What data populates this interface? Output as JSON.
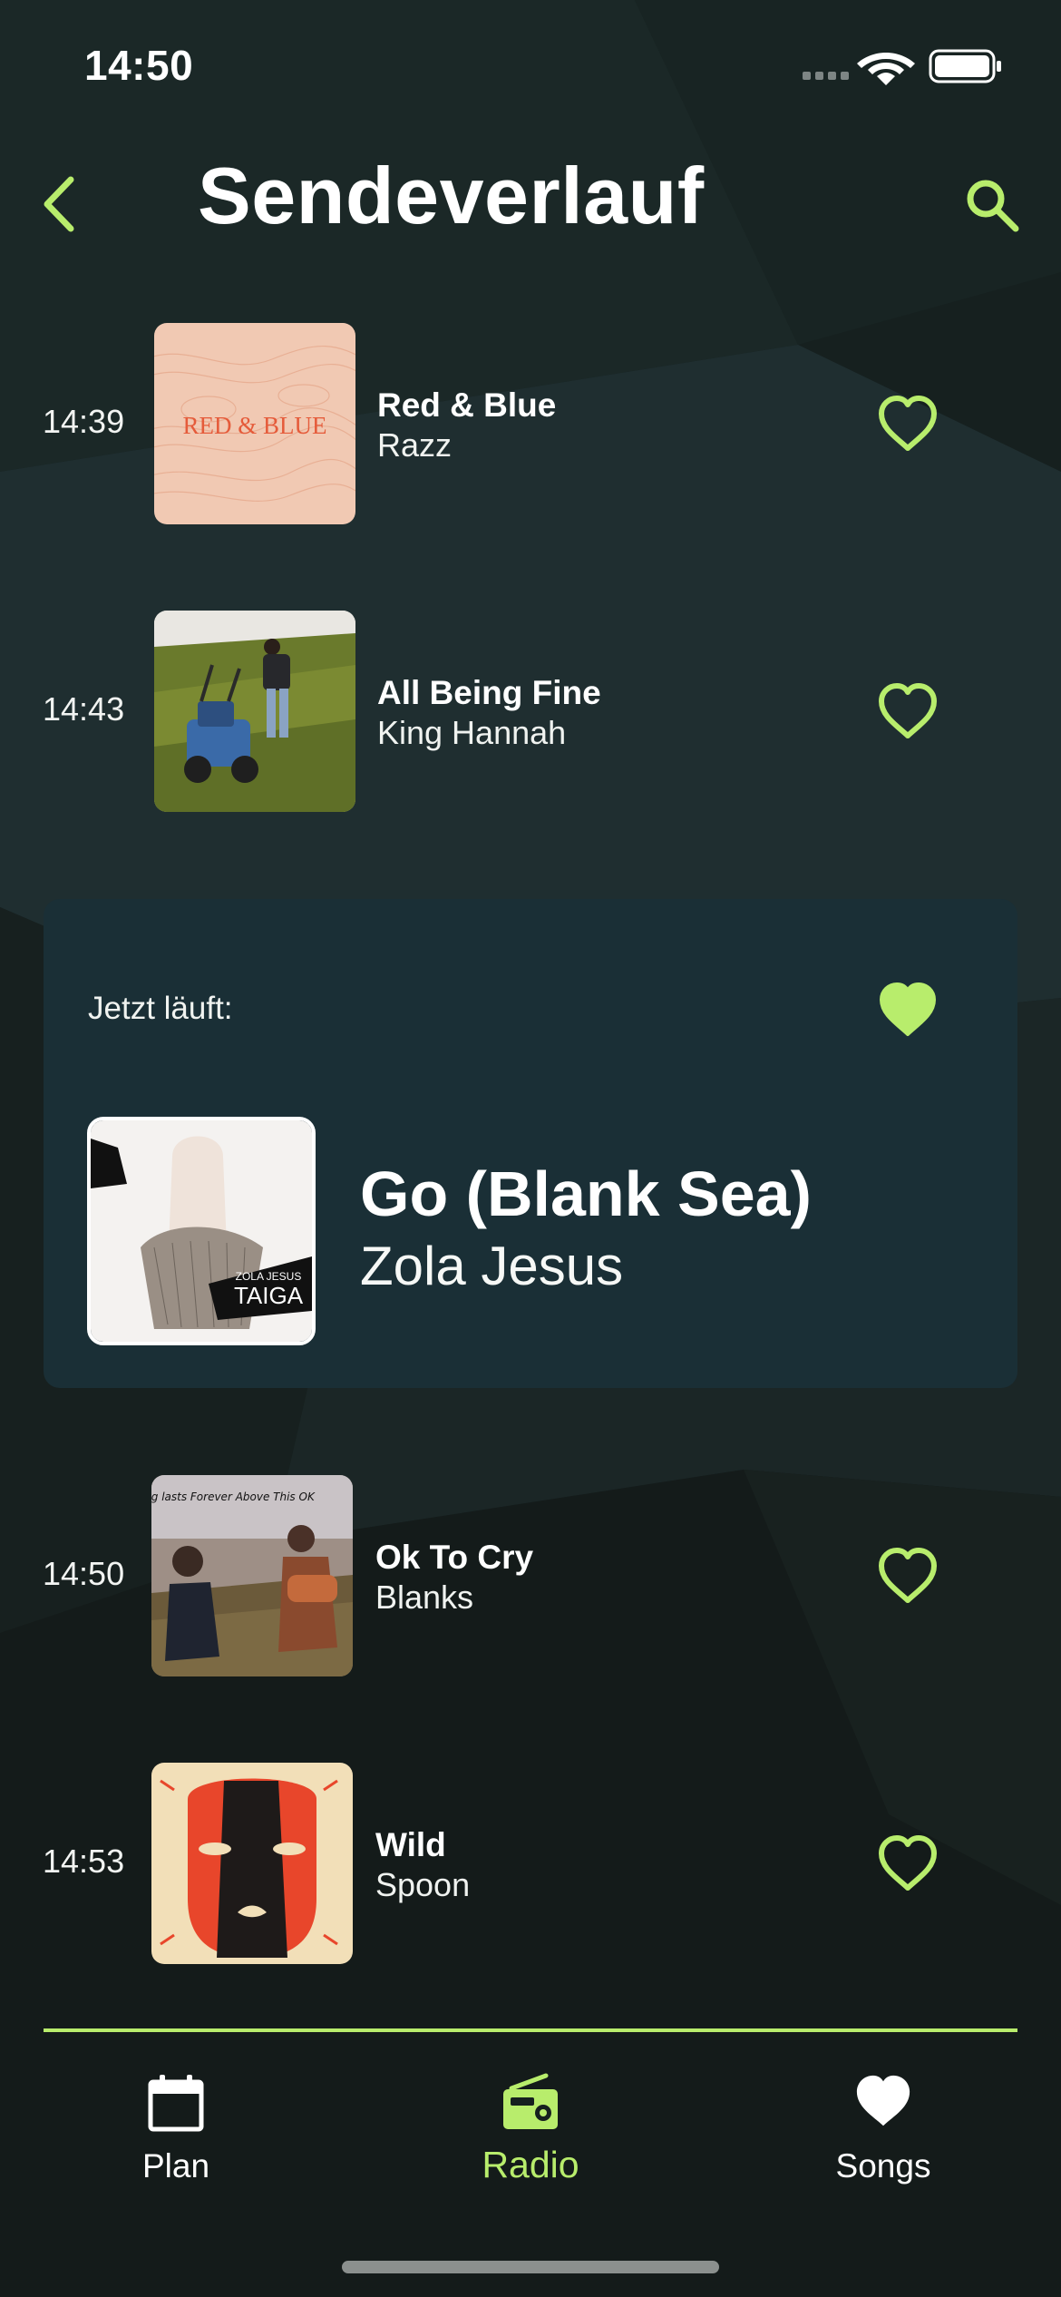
{
  "status_bar": {
    "time": "14:50",
    "icons": [
      "cellular-signal-icon",
      "wifi-icon",
      "battery-icon"
    ]
  },
  "header": {
    "title": "Sendeverlauf",
    "back_icon": "chevron-left-icon",
    "search_icon": "search-icon"
  },
  "colors": {
    "accent": "#b8ed6c",
    "background": "#16201f",
    "card": "#1a2f36",
    "text": "#ffffff"
  },
  "history_before": [
    {
      "time": "14:39",
      "title": "Red & Blue",
      "artist": "Razz",
      "cover_text": "RED & BLUE",
      "favorite": false
    },
    {
      "time": "14:43",
      "title": "All Being Fine",
      "artist": "King Hannah",
      "favorite": false
    }
  ],
  "now_playing": {
    "label": "Jetzt läuft:",
    "title": "Go (Blank Sea)",
    "artist": "Zola Jesus",
    "cover_text_top": "ZOLA JESUS",
    "cover_text_bottom": "TAIGA",
    "favorite": true
  },
  "history_after": [
    {
      "time": "14:50",
      "title": "Ok To Cry",
      "artist": "Blanks",
      "cover_text": "Nothing lasts Forever Above This OK",
      "favorite": false
    },
    {
      "time": "14:53",
      "title": "Wild",
      "artist": "Spoon",
      "favorite": false
    }
  ],
  "tabs": [
    {
      "label": "Plan",
      "icon": "calendar-icon",
      "active": false
    },
    {
      "label": "Radio",
      "icon": "radio-icon",
      "active": true
    },
    {
      "label": "Songs",
      "icon": "heart-icon",
      "active": false
    }
  ]
}
